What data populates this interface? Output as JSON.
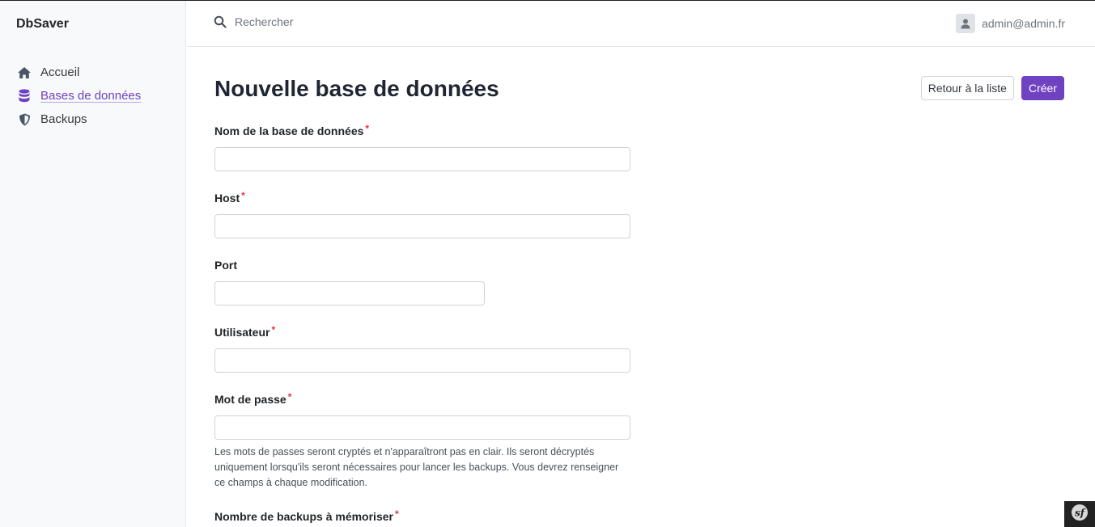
{
  "app": {
    "name": "DbSaver"
  },
  "sidebar": {
    "items": [
      {
        "label": "Accueil",
        "icon": "home-icon",
        "active": false
      },
      {
        "label": "Bases de données",
        "icon": "database-icon",
        "active": true
      },
      {
        "label": "Backups",
        "icon": "shield-icon",
        "active": false
      }
    ]
  },
  "header": {
    "search_placeholder": "Rechercher",
    "user_email": "admin@admin.fr"
  },
  "page": {
    "title": "Nouvelle base de données",
    "back_button": "Retour à la liste",
    "create_button": "Créer"
  },
  "form": {
    "name": {
      "label": "Nom de la base de données",
      "required": true,
      "value": ""
    },
    "host": {
      "label": "Host",
      "required": true,
      "value": ""
    },
    "port": {
      "label": "Port",
      "required": false,
      "value": ""
    },
    "user": {
      "label": "Utilisateur",
      "required": true,
      "value": ""
    },
    "password": {
      "label": "Mot de passe",
      "required": true,
      "value": "",
      "help": "Les mots de passes seront cryptés et n'apparaîtront pas en clair. Ils seront décryptés uniquement lorsqu'ils seront nécessaires pour lancer les backups. Vous devrez renseigner ce champs à chaque modification."
    },
    "backups_count": {
      "label": "Nombre de backups à mémoriser",
      "required": true
    }
  },
  "required_marker": "*",
  "colors": {
    "accent": "#6f42c1",
    "required": "#dc3545"
  }
}
